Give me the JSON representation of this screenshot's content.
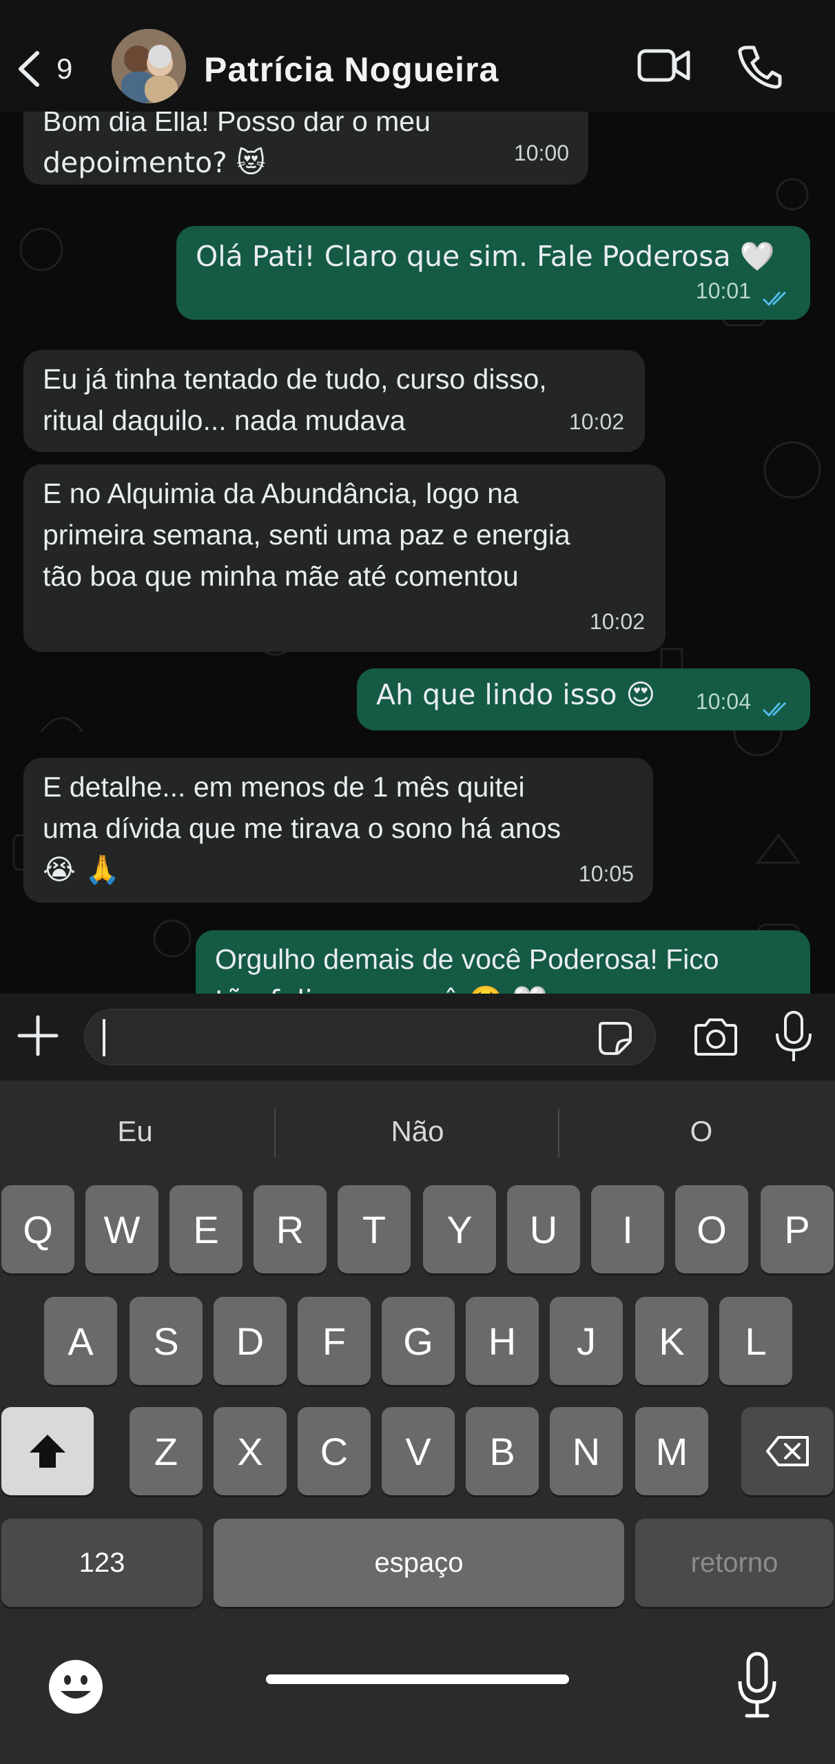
{
  "header": {
    "back_count": "9",
    "contact_name": "Patrícia Nogueira",
    "icons": [
      "back-chevron-icon",
      "video-call-icon",
      "phone-call-icon"
    ]
  },
  "messages": [
    {
      "dir": "in",
      "lines": [
        "Bom dia Ella! Posso dar o meu",
        "depoimento? 😻"
      ],
      "time": "10:00"
    },
    {
      "dir": "out",
      "lines": [
        "Olá Pati! Claro que sim. Fale Poderosa 🤍"
      ],
      "time": "10:01",
      "read": true
    },
    {
      "dir": "in",
      "lines": [
        "Eu já tinha tentado de tudo, curso disso,",
        "ritual daquilo... nada mudava"
      ],
      "time": "10:02"
    },
    {
      "dir": "in",
      "lines": [
        "E no Alquimia da Abundância, logo na",
        "primeira semana, senti uma paz e energia",
        "tão boa que minha mãe até comentou"
      ],
      "time": "10:02"
    },
    {
      "dir": "out",
      "lines": [
        "Ah que lindo isso 😍"
      ],
      "time": "10:04",
      "read": true
    },
    {
      "dir": "in",
      "lines": [
        "E detalhe... em menos de 1 mês quitei",
        "uma dívida que me tirava o sono há anos",
        "😭 🙏"
      ],
      "time": "10:05"
    },
    {
      "dir": "out",
      "lines": [
        "Orgulho demais de você Poderosa! Fico",
        "tão feliz por você 🥹 🤍"
      ],
      "time": ""
    }
  ],
  "input": {
    "value": "",
    "icons": [
      "plus-icon",
      "sticker-icon",
      "camera-icon",
      "microphone-icon"
    ]
  },
  "keyboard": {
    "suggestions": [
      "Eu",
      "Não",
      "O"
    ],
    "row1": [
      "Q",
      "W",
      "E",
      "R",
      "T",
      "Y",
      "U",
      "I",
      "O",
      "P"
    ],
    "row2": [
      "A",
      "S",
      "D",
      "F",
      "G",
      "H",
      "J",
      "K",
      "L"
    ],
    "row3": [
      "Z",
      "X",
      "C",
      "V",
      "B",
      "N",
      "M"
    ],
    "numbers_key": "123",
    "space_key": "espaço",
    "return_key": "retorno",
    "icons": [
      "shift-icon",
      "delete-icon",
      "emoji-icon",
      "dictation-mic-icon"
    ]
  },
  "colors": {
    "incoming_bubble": "#242626",
    "outgoing_bubble": "#145a45",
    "read_ticks": "#53bdeb",
    "background": "#0b0b0b"
  }
}
